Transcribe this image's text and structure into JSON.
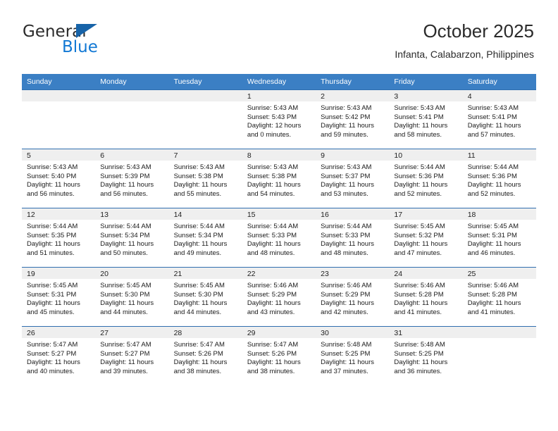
{
  "brand": {
    "name_top": "General",
    "name_bottom": "Blue",
    "triangle_color": "#1763a8",
    "blue_color": "#1178d4"
  },
  "header": {
    "title": "October 2025",
    "subtitle": "Infanta, Calabarzon, Philippines"
  },
  "theme": {
    "header_bg": "#3b7fc4",
    "header_text": "#ffffff",
    "daynum_band_bg": "#efefef",
    "grid_line": "#2f6eaf"
  },
  "weekdays": [
    "Sunday",
    "Monday",
    "Tuesday",
    "Wednesday",
    "Thursday",
    "Friday",
    "Saturday"
  ],
  "weeks": [
    [
      {
        "day": "",
        "empty": true,
        "sunrise": "",
        "sunset": "",
        "daylight1": "",
        "daylight2": ""
      },
      {
        "day": "",
        "empty": true,
        "sunrise": "",
        "sunset": "",
        "daylight1": "",
        "daylight2": ""
      },
      {
        "day": "",
        "empty": true,
        "sunrise": "",
        "sunset": "",
        "daylight1": "",
        "daylight2": ""
      },
      {
        "day": "1",
        "empty": false,
        "sunrise": "Sunrise: 5:43 AM",
        "sunset": "Sunset: 5:43 PM",
        "daylight1": "Daylight: 12 hours",
        "daylight2": "and 0 minutes."
      },
      {
        "day": "2",
        "empty": false,
        "sunrise": "Sunrise: 5:43 AM",
        "sunset": "Sunset: 5:42 PM",
        "daylight1": "Daylight: 11 hours",
        "daylight2": "and 59 minutes."
      },
      {
        "day": "3",
        "empty": false,
        "sunrise": "Sunrise: 5:43 AM",
        "sunset": "Sunset: 5:41 PM",
        "daylight1": "Daylight: 11 hours",
        "daylight2": "and 58 minutes."
      },
      {
        "day": "4",
        "empty": false,
        "sunrise": "Sunrise: 5:43 AM",
        "sunset": "Sunset: 5:41 PM",
        "daylight1": "Daylight: 11 hours",
        "daylight2": "and 57 minutes."
      }
    ],
    [
      {
        "day": "5",
        "empty": false,
        "sunrise": "Sunrise: 5:43 AM",
        "sunset": "Sunset: 5:40 PM",
        "daylight1": "Daylight: 11 hours",
        "daylight2": "and 56 minutes."
      },
      {
        "day": "6",
        "empty": false,
        "sunrise": "Sunrise: 5:43 AM",
        "sunset": "Sunset: 5:39 PM",
        "daylight1": "Daylight: 11 hours",
        "daylight2": "and 56 minutes."
      },
      {
        "day": "7",
        "empty": false,
        "sunrise": "Sunrise: 5:43 AM",
        "sunset": "Sunset: 5:38 PM",
        "daylight1": "Daylight: 11 hours",
        "daylight2": "and 55 minutes."
      },
      {
        "day": "8",
        "empty": false,
        "sunrise": "Sunrise: 5:43 AM",
        "sunset": "Sunset: 5:38 PM",
        "daylight1": "Daylight: 11 hours",
        "daylight2": "and 54 minutes."
      },
      {
        "day": "9",
        "empty": false,
        "sunrise": "Sunrise: 5:43 AM",
        "sunset": "Sunset: 5:37 PM",
        "daylight1": "Daylight: 11 hours",
        "daylight2": "and 53 minutes."
      },
      {
        "day": "10",
        "empty": false,
        "sunrise": "Sunrise: 5:44 AM",
        "sunset": "Sunset: 5:36 PM",
        "daylight1": "Daylight: 11 hours",
        "daylight2": "and 52 minutes."
      },
      {
        "day": "11",
        "empty": false,
        "sunrise": "Sunrise: 5:44 AM",
        "sunset": "Sunset: 5:36 PM",
        "daylight1": "Daylight: 11 hours",
        "daylight2": "and 52 minutes."
      }
    ],
    [
      {
        "day": "12",
        "empty": false,
        "sunrise": "Sunrise: 5:44 AM",
        "sunset": "Sunset: 5:35 PM",
        "daylight1": "Daylight: 11 hours",
        "daylight2": "and 51 minutes."
      },
      {
        "day": "13",
        "empty": false,
        "sunrise": "Sunrise: 5:44 AM",
        "sunset": "Sunset: 5:34 PM",
        "daylight1": "Daylight: 11 hours",
        "daylight2": "and 50 minutes."
      },
      {
        "day": "14",
        "empty": false,
        "sunrise": "Sunrise: 5:44 AM",
        "sunset": "Sunset: 5:34 PM",
        "daylight1": "Daylight: 11 hours",
        "daylight2": "and 49 minutes."
      },
      {
        "day": "15",
        "empty": false,
        "sunrise": "Sunrise: 5:44 AM",
        "sunset": "Sunset: 5:33 PM",
        "daylight1": "Daylight: 11 hours",
        "daylight2": "and 48 minutes."
      },
      {
        "day": "16",
        "empty": false,
        "sunrise": "Sunrise: 5:44 AM",
        "sunset": "Sunset: 5:33 PM",
        "daylight1": "Daylight: 11 hours",
        "daylight2": "and 48 minutes."
      },
      {
        "day": "17",
        "empty": false,
        "sunrise": "Sunrise: 5:45 AM",
        "sunset": "Sunset: 5:32 PM",
        "daylight1": "Daylight: 11 hours",
        "daylight2": "and 47 minutes."
      },
      {
        "day": "18",
        "empty": false,
        "sunrise": "Sunrise: 5:45 AM",
        "sunset": "Sunset: 5:31 PM",
        "daylight1": "Daylight: 11 hours",
        "daylight2": "and 46 minutes."
      }
    ],
    [
      {
        "day": "19",
        "empty": false,
        "sunrise": "Sunrise: 5:45 AM",
        "sunset": "Sunset: 5:31 PM",
        "daylight1": "Daylight: 11 hours",
        "daylight2": "and 45 minutes."
      },
      {
        "day": "20",
        "empty": false,
        "sunrise": "Sunrise: 5:45 AM",
        "sunset": "Sunset: 5:30 PM",
        "daylight1": "Daylight: 11 hours",
        "daylight2": "and 44 minutes."
      },
      {
        "day": "21",
        "empty": false,
        "sunrise": "Sunrise: 5:45 AM",
        "sunset": "Sunset: 5:30 PM",
        "daylight1": "Daylight: 11 hours",
        "daylight2": "and 44 minutes."
      },
      {
        "day": "22",
        "empty": false,
        "sunrise": "Sunrise: 5:46 AM",
        "sunset": "Sunset: 5:29 PM",
        "daylight1": "Daylight: 11 hours",
        "daylight2": "and 43 minutes."
      },
      {
        "day": "23",
        "empty": false,
        "sunrise": "Sunrise: 5:46 AM",
        "sunset": "Sunset: 5:29 PM",
        "daylight1": "Daylight: 11 hours",
        "daylight2": "and 42 minutes."
      },
      {
        "day": "24",
        "empty": false,
        "sunrise": "Sunrise: 5:46 AM",
        "sunset": "Sunset: 5:28 PM",
        "daylight1": "Daylight: 11 hours",
        "daylight2": "and 41 minutes."
      },
      {
        "day": "25",
        "empty": false,
        "sunrise": "Sunrise: 5:46 AM",
        "sunset": "Sunset: 5:28 PM",
        "daylight1": "Daylight: 11 hours",
        "daylight2": "and 41 minutes."
      }
    ],
    [
      {
        "day": "26",
        "empty": false,
        "sunrise": "Sunrise: 5:47 AM",
        "sunset": "Sunset: 5:27 PM",
        "daylight1": "Daylight: 11 hours",
        "daylight2": "and 40 minutes."
      },
      {
        "day": "27",
        "empty": false,
        "sunrise": "Sunrise: 5:47 AM",
        "sunset": "Sunset: 5:27 PM",
        "daylight1": "Daylight: 11 hours",
        "daylight2": "and 39 minutes."
      },
      {
        "day": "28",
        "empty": false,
        "sunrise": "Sunrise: 5:47 AM",
        "sunset": "Sunset: 5:26 PM",
        "daylight1": "Daylight: 11 hours",
        "daylight2": "and 38 minutes."
      },
      {
        "day": "29",
        "empty": false,
        "sunrise": "Sunrise: 5:47 AM",
        "sunset": "Sunset: 5:26 PM",
        "daylight1": "Daylight: 11 hours",
        "daylight2": "and 38 minutes."
      },
      {
        "day": "30",
        "empty": false,
        "sunrise": "Sunrise: 5:48 AM",
        "sunset": "Sunset: 5:25 PM",
        "daylight1": "Daylight: 11 hours",
        "daylight2": "and 37 minutes."
      },
      {
        "day": "31",
        "empty": false,
        "sunrise": "Sunrise: 5:48 AM",
        "sunset": "Sunset: 5:25 PM",
        "daylight1": "Daylight: 11 hours",
        "daylight2": "and 36 minutes."
      },
      {
        "day": "",
        "empty": true,
        "sunrise": "",
        "sunset": "",
        "daylight1": "",
        "daylight2": ""
      }
    ]
  ]
}
